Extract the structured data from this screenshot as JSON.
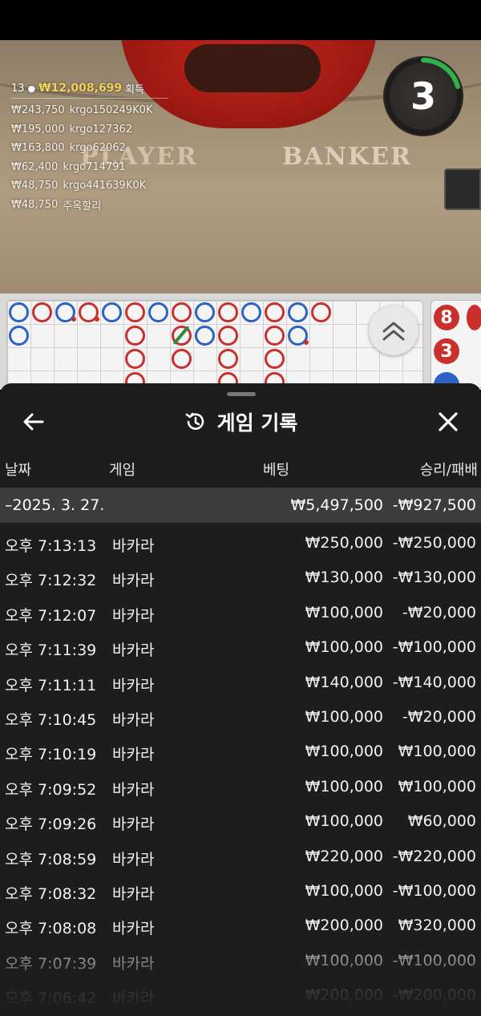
{
  "live_table": {
    "timer": "3",
    "label_player": "PLAYER",
    "label_banker": "BANKER",
    "winners": {
      "count": "13",
      "total": "₩12,008,699",
      "suffix": "획득",
      "list": [
        {
          "amount": "₩243,750",
          "user": "krgo150249K0K"
        },
        {
          "amount": "₩195,000",
          "user": "krgo127362"
        },
        {
          "amount": "₩163,800",
          "user": "krgo62062"
        },
        {
          "amount": "₩62,400",
          "user": "krgo714791"
        },
        {
          "amount": "₩48,750",
          "user": "krgo441639K0K"
        },
        {
          "amount": "₩48,750",
          "user": "주옥할리"
        }
      ]
    },
    "bead_numbers": [
      "8",
      "3"
    ]
  },
  "colors": {
    "banker_red": "#c9302c",
    "player_blue": "#2b62c4",
    "tie_green": "#2a8a3a",
    "sheet_bg": "#1d1d1d",
    "date_row_bg": "#3c3c3c"
  },
  "history": {
    "title": "게임 기록",
    "title_icon": "history-icon",
    "back_icon": "arrow-left-icon",
    "close_icon": "close-icon",
    "columns": {
      "date": "날짜",
      "game": "게임",
      "bet": "베팅",
      "result": "승리/패배"
    },
    "date_group": {
      "date": "–2025. 3. 27.",
      "bet_total": "₩5,497,500",
      "result_total": "-₩927,500"
    },
    "rows": [
      {
        "time": "오후 7:13:13",
        "game": "바카라",
        "bet": "₩250,000",
        "result": "-₩250,000"
      },
      {
        "time": "오후 7:12:32",
        "game": "바카라",
        "bet": "₩130,000",
        "result": "-₩130,000"
      },
      {
        "time": "오후 7:12:07",
        "game": "바카라",
        "bet": "₩100,000",
        "result": "-₩20,000"
      },
      {
        "time": "오후 7:11:39",
        "game": "바카라",
        "bet": "₩100,000",
        "result": "-₩100,000"
      },
      {
        "time": "오후 7:11:11",
        "game": "바카라",
        "bet": "₩140,000",
        "result": "-₩140,000"
      },
      {
        "time": "오후 7:10:45",
        "game": "바카라",
        "bet": "₩100,000",
        "result": "-₩20,000"
      },
      {
        "time": "오후 7:10:19",
        "game": "바카라",
        "bet": "₩100,000",
        "result": "₩100,000"
      },
      {
        "time": "오후 7:09:52",
        "game": "바카라",
        "bet": "₩100,000",
        "result": "₩100,000"
      },
      {
        "time": "오후 7:09:26",
        "game": "바카라",
        "bet": "₩100,000",
        "result": "₩60,000"
      },
      {
        "time": "오후 7:08:59",
        "game": "바카라",
        "bet": "₩220,000",
        "result": "-₩220,000"
      },
      {
        "time": "오후 7:08:32",
        "game": "바카라",
        "bet": "₩100,000",
        "result": "-₩100,000"
      },
      {
        "time": "오후 7:08:08",
        "game": "바카라",
        "bet": "₩200,000",
        "result": "₩320,000"
      },
      {
        "time": "오후 7:07:39",
        "game": "바카라",
        "bet": "₩100,000",
        "result": "-₩100,000"
      },
      {
        "time": "오후 7:06:42",
        "game": "바카라",
        "bet": "₩200,000",
        "result": "-₩200,000"
      }
    ]
  }
}
